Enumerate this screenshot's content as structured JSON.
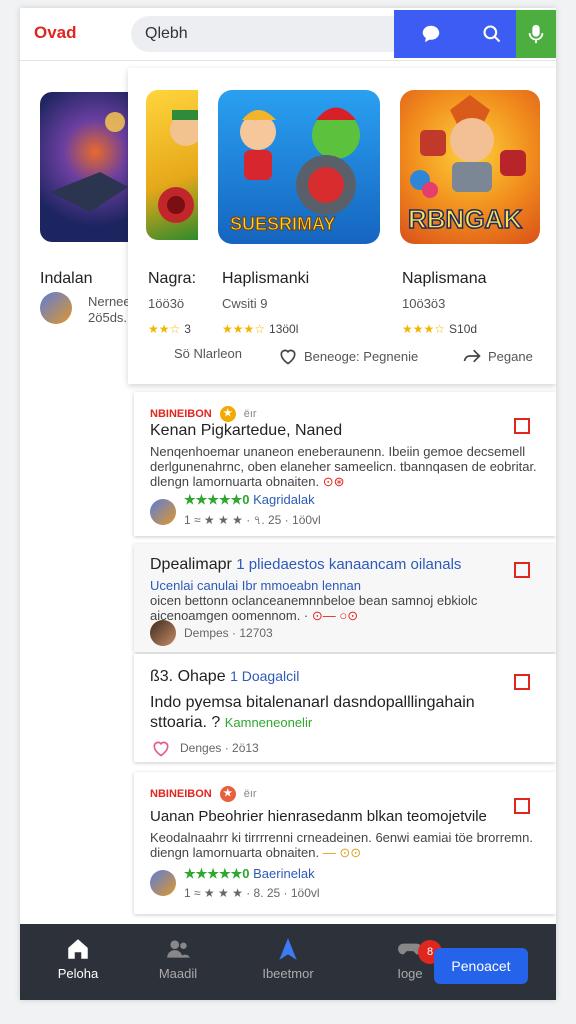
{
  "header": {
    "brand": "Ovad",
    "search_placeholder": "Qlebh",
    "icons": [
      "chat-icon",
      "search-icon",
      "mic-icon"
    ]
  },
  "apps": [
    {
      "name": "Indalan",
      "sub_title": "Nernee",
      "sub_meta": "2ö5ds. 1"
    },
    {
      "name": "Nagra:",
      "sub_meta": "1öö3ö",
      "rating_text": "3"
    },
    {
      "name": "Haplismanki",
      "sub_meta": "Cwsiti 9",
      "rating_text": "13ö0l"
    },
    {
      "name": "Naplismana",
      "sub_meta": "10ö3ö3",
      "rating_text": "S10d"
    }
  ],
  "actions": {
    "a1": "Sö Nlarleon",
    "a2": "Beneoge: Pegnenie",
    "a3": "Pegane"
  },
  "posts": [
    {
      "tag": "NBINEIBON",
      "tag_sm": "ёır",
      "title": "Kenan Pigkartedue, Naned",
      "body1": "Nenqenhoemar unaneon eneberaunenn. Ibeiin gemoe decsemell",
      "body2": "derlgunenahrnc, oben elaneher sameelicn. tbannqasen de eobritar.",
      "body3": "dlengn lamornuarta obnaiten.",
      "rating": "★★★★★0",
      "link": "Kagridalak",
      "meta": "1 ≈ ★ ★ ★ · ৭. 25 · 1ö0vl"
    },
    {
      "title_a": "Dpealimapr",
      "title_b": "1 pliedaestos kanaancam oilanals",
      "body1": "Ucenlai canulai Ibr mmoeabn lennan",
      "body2": "oicen bettonn  oclanceanemnnbeloe bean samnoj ebkiolc",
      "body3": "aicenoamgen oomennom. ·",
      "meta": "Dempes · 12703"
    },
    {
      "title_a": "ß3. Ohape",
      "title_b": "1 Doagalcil",
      "body1": "Indo pyemsa bitalenanarl dasndopalllingahain",
      "body2": "sttoaria. ?",
      "link": "Kamneneonelir",
      "meta": "Denges · 2ö13"
    },
    {
      "tag": "NBINEIBON",
      "tag_sm": "ёır",
      "title": "Uanan Pbeohrier hienrasedanm blkan teomojetvile",
      "body1": "Keodalnaahrr ki tirrrrenni crneadeinen. 6enwi eamiai töe brorremn.",
      "body2": "diengn lamornuarta obnaiten.",
      "rating": "★★★★★0",
      "link": "Baerinelak",
      "meta": "1 ≈ ★ ★ ★ · 8. 25 · 1ö0vl"
    }
  ],
  "nav": {
    "items": [
      "Peloha",
      "Maadil",
      "Ibeetmor",
      "Ioge"
    ],
    "cta": "Penoacet",
    "badge": "8"
  }
}
